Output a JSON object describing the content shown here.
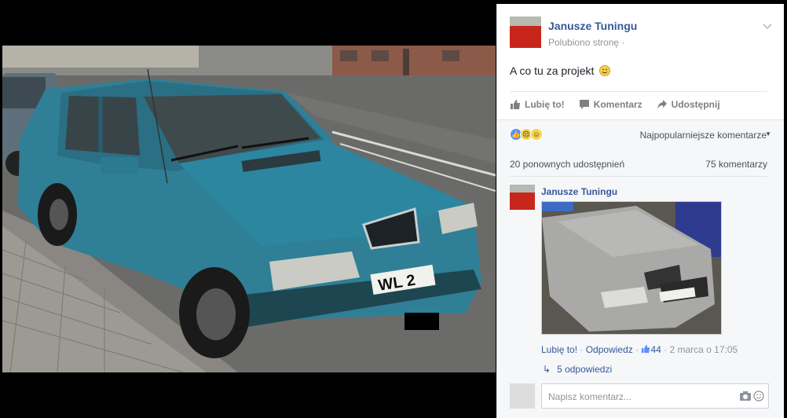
{
  "post": {
    "page_name": "Janusze Tuningu",
    "liked_label": "Polubiono stronę ·",
    "text": "A co tu za projekt",
    "actions": {
      "like": "Lubię to!",
      "comment": "Komentarz",
      "share": "Udostępnij"
    }
  },
  "comments_section": {
    "sort_label": "Najpopularniejsze komentarze",
    "shares_count": "20 ponownych udostępnień",
    "comments_count": "75 komentarzy",
    "top_comment": {
      "author": "Janusze Tuningu",
      "like_link": "Lubię to!",
      "separator": " · ",
      "reply_link": "Odpowiedz",
      "separator2": " · ",
      "likes": "44",
      "timestamp": " · 2 marca o 17:05",
      "replies_label": "5 odpowiedzi"
    },
    "compose": {
      "placeholder": "Napisz komentarz..."
    }
  },
  "photo": {
    "license_plate_text": "WL 2"
  },
  "colors": {
    "link_blue": "#365899",
    "car_teal": "#2f7f96",
    "avatar_red": "#c9261b"
  }
}
